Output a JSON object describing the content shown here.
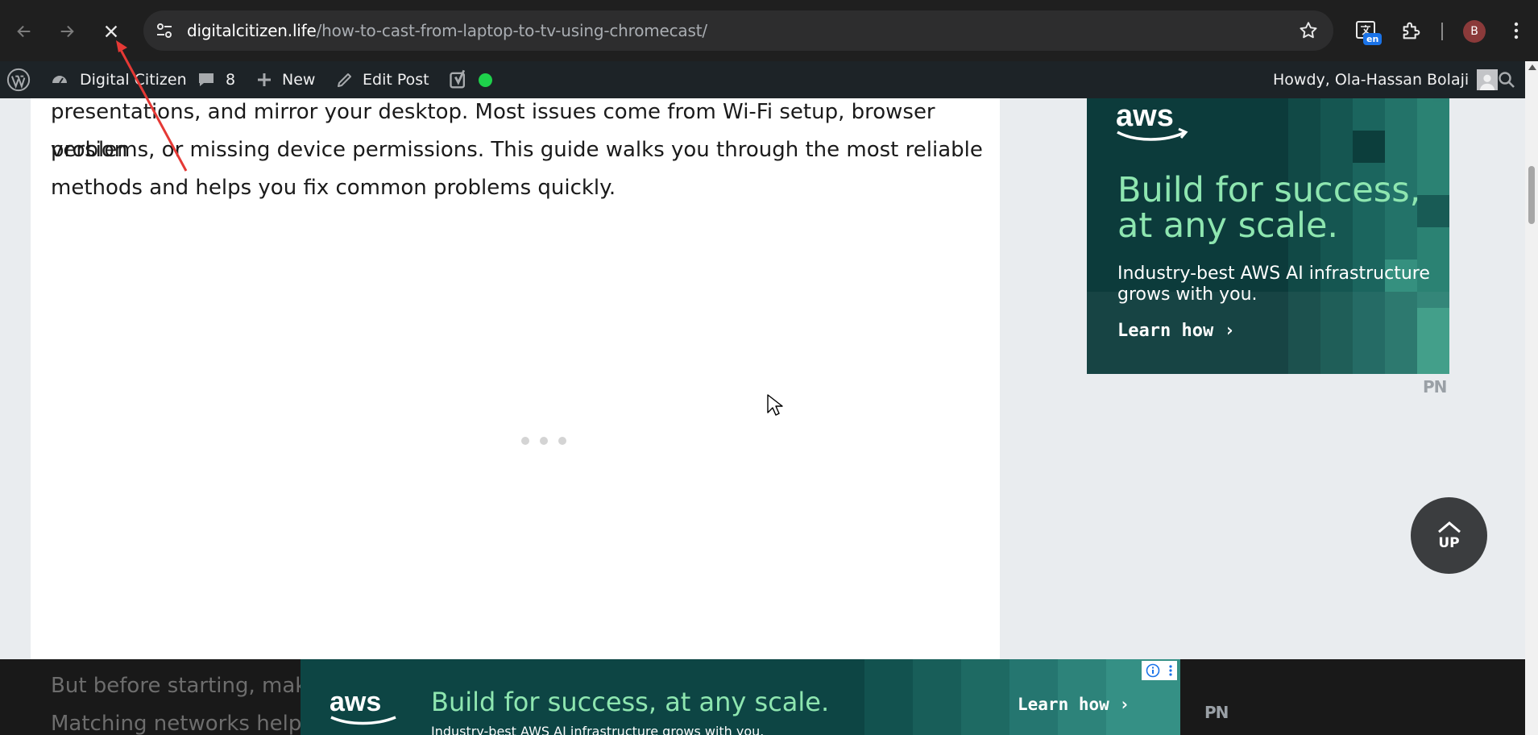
{
  "browser": {
    "url_host": "digitalcitizen.life",
    "url_path": "/how-to-cast-from-laptop-to-tv-using-chromecast/",
    "translate_badge": "en",
    "profile_initial": "B"
  },
  "adminbar": {
    "site_name": "Digital Citizen",
    "comments_count": "8",
    "new_label": "New",
    "edit_label": "Edit Post",
    "howdy": "Howdy, Ola-Hassan Bolaji"
  },
  "article": {
    "paragraph_lines": [
      "presentations, and mirror your desktop. Most issues come from Wi-Fi setup, browser version",
      "problems, or missing device permissions. This guide walks you through the most reliable",
      "methods and helps you fix common problems quickly."
    ],
    "bottom_lines": [
      "But before starting, make",
      "Matching networks helps"
    ]
  },
  "side_ad": {
    "logo": "aws",
    "headline": "Build for success, at any scale.",
    "subtext": "Industry-best AWS AI infrastructure grows with you.",
    "cta": "Learn how ›",
    "marker": "PN"
  },
  "up_button": {
    "label": "UP"
  },
  "bottom_ad": {
    "logo": "aws",
    "headline": "Build for success, at any scale.",
    "subtext": "Industry-best AWS AI infrastructure grows with you.",
    "cta": "Learn how ›",
    "marker": "PN"
  },
  "colors": {
    "aws_green": "#8ee6b0",
    "admin_bar": "#1d2327",
    "status_dot": "#1ed14b"
  }
}
